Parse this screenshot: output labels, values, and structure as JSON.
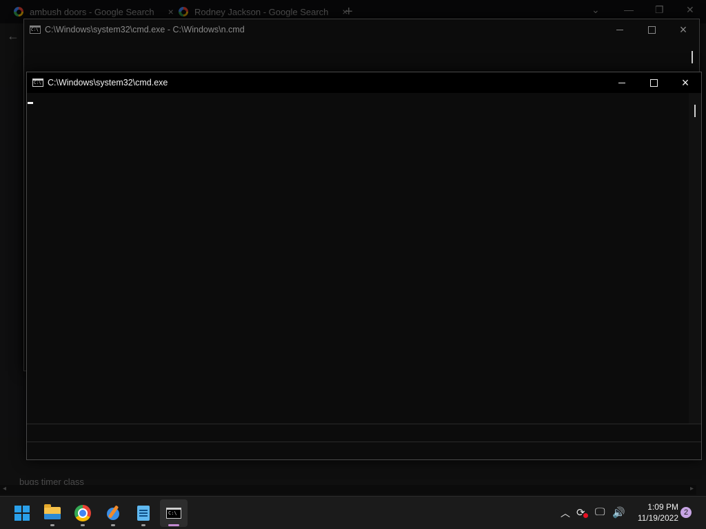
{
  "browser": {
    "tabs": [
      {
        "title": "ambush doors - Google Search",
        "close": "×"
      },
      {
        "title": "Rodney Jackson - Google Search",
        "close": "×"
      }
    ],
    "new_tab": "+",
    "page_text": "bugs timer class"
  },
  "back_console": {
    "title": "C:\\Windows\\system32\\cmd.exe - C:\\Windows\\n.cmd"
  },
  "front_console": {
    "title": "C:\\Windows\\system32\\cmd.exe"
  },
  "window_controls": {
    "close": "×"
  },
  "taskbar": {
    "apps": [
      {
        "name": "Start",
        "icon": "windows-logo-icon"
      },
      {
        "name": "File Explorer",
        "icon": "folder-icon"
      },
      {
        "name": "Google Chrome",
        "icon": "chrome-icon"
      },
      {
        "name": "Pen app",
        "icon": "pen-icon"
      },
      {
        "name": "Notepad",
        "icon": "notepad-icon"
      },
      {
        "name": "Command Prompt",
        "icon": "terminal-icon",
        "active": true
      }
    ],
    "tray": {
      "chevron": "^",
      "time": "1:09 PM",
      "date": "11/19/2022",
      "notifications": "2"
    }
  },
  "colors": {
    "console_bg": "#0c0c0c",
    "taskbar_bg": "#1b1b1b",
    "accent_pip": "#c38ad1",
    "notif_badge": "#c7a4e4"
  }
}
